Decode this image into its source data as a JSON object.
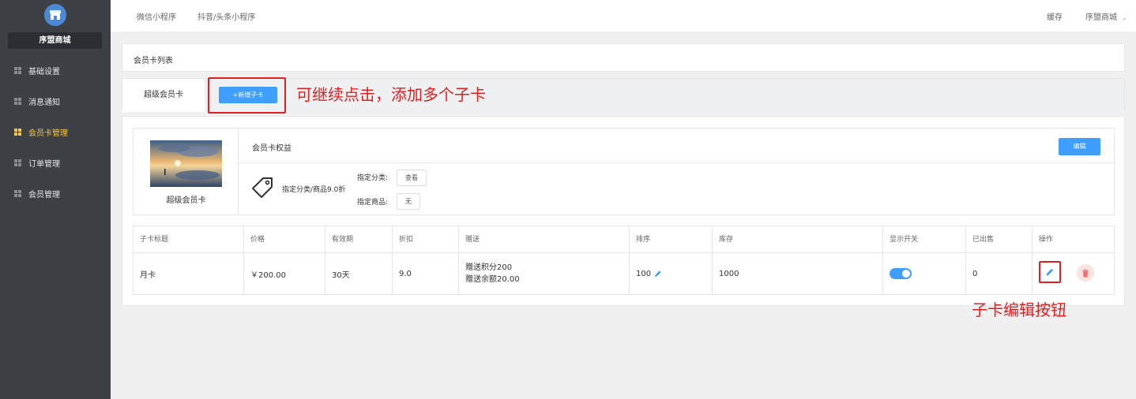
{
  "sidebar": {
    "brand": "序盟商城",
    "items": [
      {
        "label": "基础设置",
        "active": false
      },
      {
        "label": "消息通知",
        "active": false
      },
      {
        "label": "会员卡管理",
        "active": true
      },
      {
        "label": "订单管理",
        "active": false
      },
      {
        "label": "会员管理",
        "active": false
      }
    ]
  },
  "topbar": {
    "tabs": [
      "微信小程序",
      "抖音/头条小程序"
    ],
    "cache": "缓存",
    "account": "序盟商城"
  },
  "panel": {
    "title": "会员卡列表",
    "active_tab": "超级会员卡",
    "add_button": "+新增子卡",
    "annotation_add": "可继续点击，添加多个子卡"
  },
  "card": {
    "name": "超级会员卡",
    "rights_title": "会员卡权益",
    "edit_button": "编辑",
    "discount": "指定分类/商品9.0折",
    "category_label": "指定分类:",
    "category_button": "查看",
    "goods_label": "指定商品:",
    "goods_button": "无"
  },
  "table": {
    "headers": [
      "子卡标题",
      "价格",
      "有效期",
      "折扣",
      "赠送",
      "排序",
      "库存",
      "显示开关",
      "已出售",
      "操作"
    ],
    "rows": [
      {
        "title": "月卡",
        "price": "￥200.00",
        "validity": "30天",
        "discount": "9.0",
        "gift_line1": "赠送积分200",
        "gift_line2": "赠送余额20.00",
        "sort": "100",
        "stock": "1000",
        "visible": true,
        "sold": "0"
      }
    ],
    "annotation_edit": "子卡编辑按钮"
  },
  "colors": {
    "accent": "#409eff",
    "sidebar_bg": "#3d4146",
    "active_nav": "#f5c84a",
    "annotation": "#e02020"
  }
}
